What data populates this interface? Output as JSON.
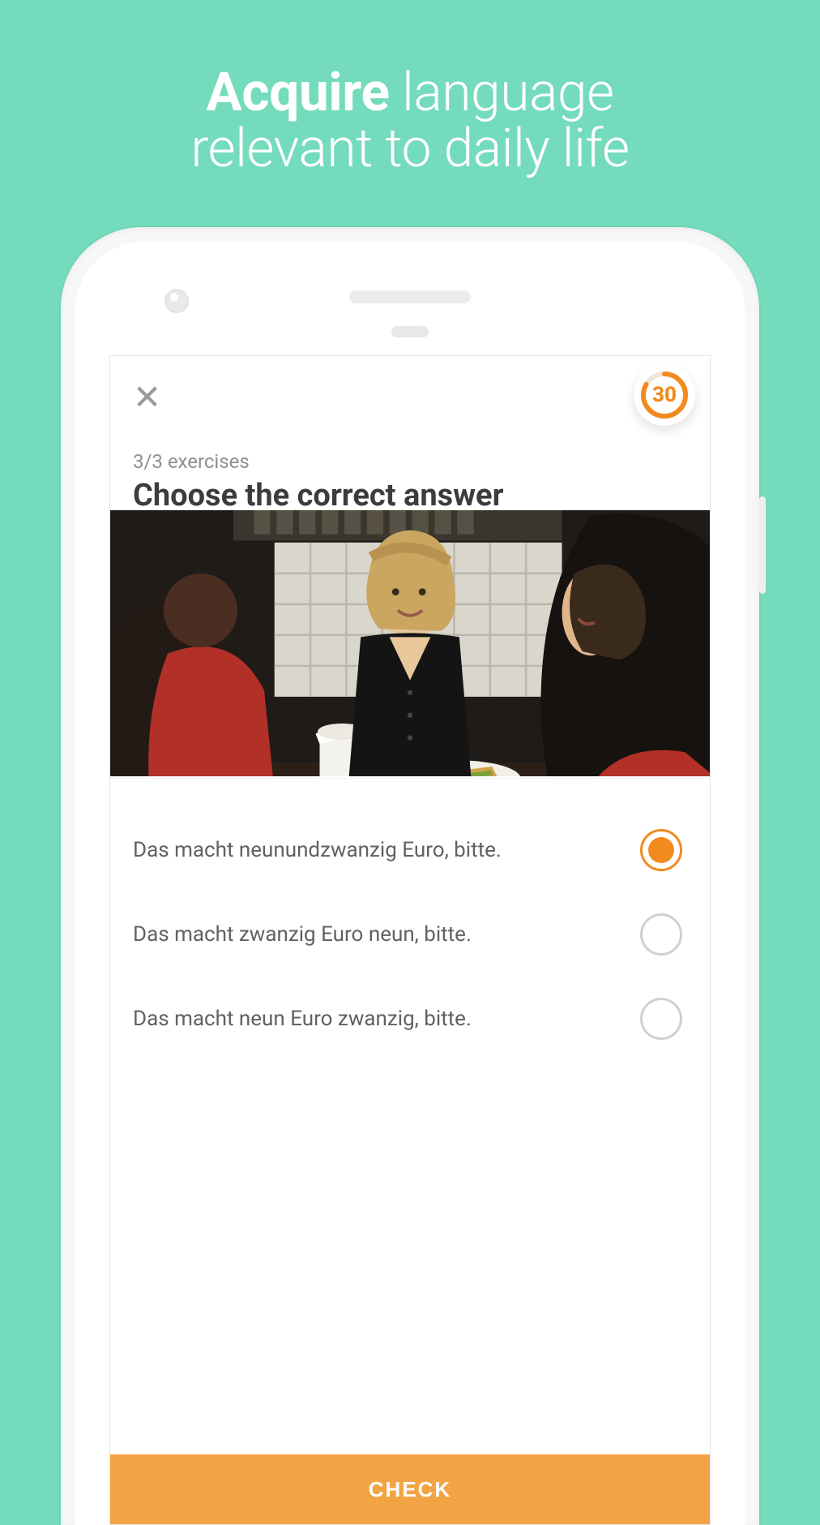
{
  "marketing": {
    "headline_bold": "Acquire",
    "headline_rest_line1": " language",
    "headline_line2": "relevant to daily life"
  },
  "app": {
    "timer_value": "30",
    "timer_progress_deg": 300,
    "progress_label": "3/3 exercises",
    "question": "Choose the correct answer",
    "options": [
      {
        "text": "Das macht neunundzwanzig Euro, bitte.",
        "selected": true
      },
      {
        "text": "Das macht zwanzig Euro neun, bitte.",
        "selected": false
      },
      {
        "text": "Das macht neun Euro zwanzig, bitte.",
        "selected": false
      }
    ],
    "check_label": "CHECK",
    "accent": "#f28a1e",
    "accent_soft": "#f2a444"
  }
}
